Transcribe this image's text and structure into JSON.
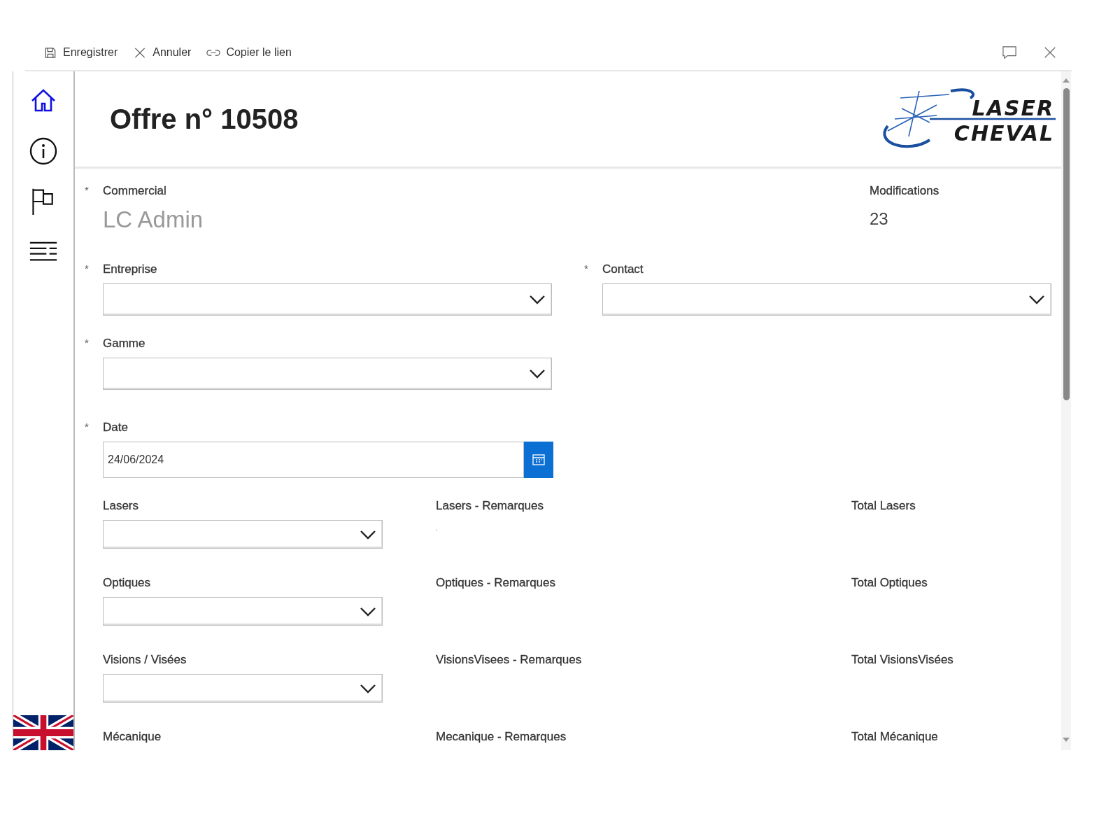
{
  "toolbar": {
    "actions": [
      {
        "kind": "save",
        "label": "Enregistrer"
      },
      {
        "kind": "cancel",
        "label": "Annuler"
      },
      {
        "kind": "link",
        "label": "Copier le lien"
      }
    ]
  },
  "sidebar": {
    "items": [
      {
        "kind": "home",
        "selected": true
      },
      {
        "kind": "info",
        "selected": false
      },
      {
        "kind": "flag",
        "selected": false
      },
      {
        "kind": "list",
        "selected": false
      }
    ]
  },
  "header": {
    "title": "Offre n° 10508",
    "logo": [
      "LASER",
      "CHEVAL"
    ]
  },
  "commercial": {
    "label": "Commercial",
    "required_mark": "*",
    "value": "LC Admin"
  },
  "modifications": {
    "label": "Modifications",
    "value": "23"
  },
  "entreprise": {
    "label": "Entreprise",
    "required_mark": "*"
  },
  "contact": {
    "label": "Contact",
    "required_mark": "*"
  },
  "gamme": {
    "label": "Gamme",
    "required_mark": "*"
  },
  "date": {
    "label": "Date",
    "required_mark": "*",
    "value": "24/06/2024"
  },
  "sections": [
    {
      "label": "Lasers",
      "remarks_label": "Lasers - Remarques",
      "remarks_value": ".",
      "total_label": "Total Lasers"
    },
    {
      "label": "Optiques",
      "remarks_label": "Optiques - Remarques",
      "total_label": "Total Optiques"
    },
    {
      "label": "Visions / Visées",
      "remarks_label": "VisionsVisees - Remarques",
      "total_label": "Total VisionsVisées"
    },
    {
      "label": "Mécanique",
      "remarks_label": "Mecanique - Remarques",
      "total_label": "Total Mécanique"
    }
  ]
}
